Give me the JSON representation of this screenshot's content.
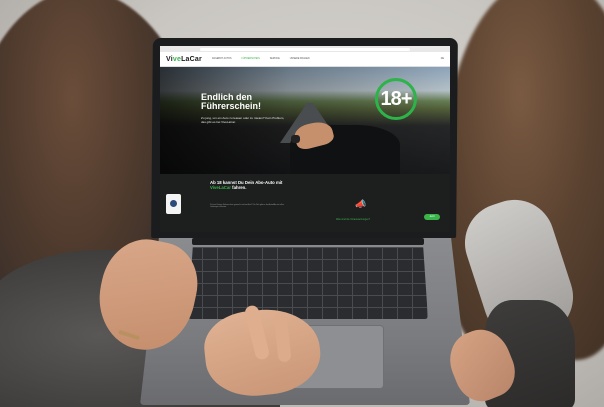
{
  "website": {
    "logo": {
      "part1": "Vi",
      "part2": "ve",
      "part3": "LaCar"
    },
    "nav": [
      "ANGEBOT AUTOS",
      "FÜHRERSCHEIN",
      "SERVICE",
      "UNSERE FRAGEN"
    ],
    "nav_right": "DE",
    "hero": {
      "title": "Endlich den Führerschein!",
      "subtitle": "Zu jung, um ein Auto zu leasen oder zu mieten? Kein Problem, das gibt es bei ViveLaCar.",
      "badge": "18+"
    },
    "bottom": {
      "headline_prefix": "Ab 18 kannst Du Dein Abo-Auto mit ",
      "brand": "ViveLaCar",
      "headline_suffix": " fahren.",
      "small_text": "Du hast Deinen Führerschein gemacht und ein Auto? Für Dich gibt es das Auto-Abo mit allen Leistungen inklusive.",
      "question_link": "Was sind die Voraussetzungen?",
      "cta_label": "Jetzt"
    }
  },
  "colors": {
    "brand_green": "#39b54a",
    "hero_dark": "#1d1f1e"
  }
}
